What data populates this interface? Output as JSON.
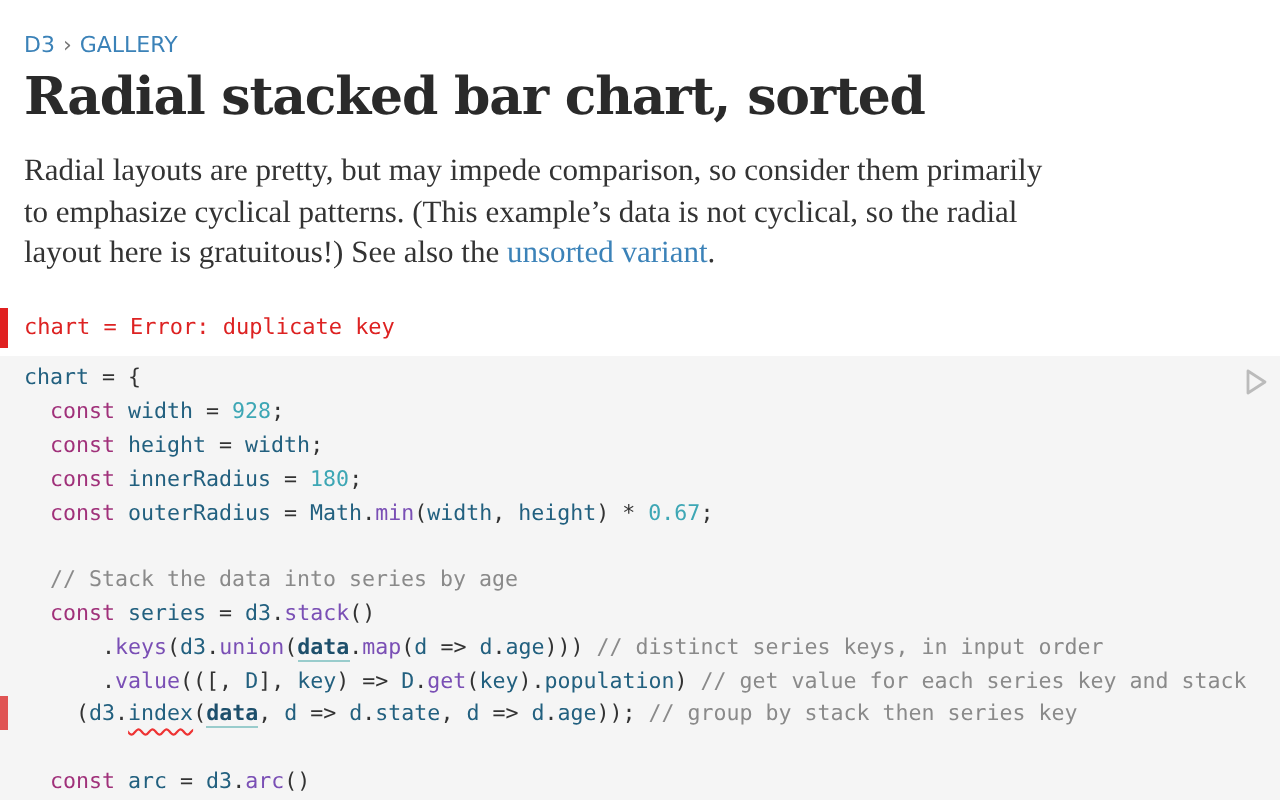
{
  "breadcrumb": {
    "items": [
      "D3",
      "GALLERY"
    ],
    "separator": "›"
  },
  "title": "Radial stacked bar chart, sorted",
  "description": {
    "text": "Radial layouts are pretty, but may impede comparison, so consider them primarily to emphasize cyclical patterns. (This example’s data is not cyclical, so the radial layout here is gratuitous!) See also the ",
    "link": "unsorted variant",
    "after": "."
  },
  "error_cell": {
    "text": "chart = Error: duplicate key"
  },
  "code": [
    {
      "flagged": false,
      "tokens": [
        {
          "kind": "variable",
          "text": "chart"
        },
        {
          "kind": "punct",
          "text": " = {"
        }
      ]
    },
    {
      "flagged": false,
      "tokens": [
        {
          "kind": "keyword",
          "text": "  const "
        },
        {
          "kind": "variable",
          "text": "width"
        },
        {
          "kind": "punct",
          "text": " = "
        },
        {
          "kind": "number",
          "text": "928"
        },
        {
          "kind": "punct",
          "text": ";"
        }
      ]
    },
    {
      "flagged": false,
      "tokens": [
        {
          "kind": "keyword",
          "text": "  const "
        },
        {
          "kind": "variable",
          "text": "height"
        },
        {
          "kind": "punct",
          "text": " = "
        },
        {
          "kind": "variable",
          "text": "width"
        },
        {
          "kind": "punct",
          "text": ";"
        }
      ]
    },
    {
      "flagged": false,
      "tokens": [
        {
          "kind": "keyword",
          "text": "  const "
        },
        {
          "kind": "variable",
          "text": "innerRadius"
        },
        {
          "kind": "punct",
          "text": " = "
        },
        {
          "kind": "number",
          "text": "180"
        },
        {
          "kind": "punct",
          "text": ";"
        }
      ]
    },
    {
      "flagged": false,
      "tokens": [
        {
          "kind": "keyword",
          "text": "  const "
        },
        {
          "kind": "variable",
          "text": "outerRadius"
        },
        {
          "kind": "punct",
          "text": " = "
        },
        {
          "kind": "variable",
          "text": "Math"
        },
        {
          "kind": "punct",
          "text": "."
        },
        {
          "kind": "method",
          "text": "min"
        },
        {
          "kind": "punct",
          "text": "("
        },
        {
          "kind": "variable",
          "text": "width"
        },
        {
          "kind": "punct",
          "text": ", "
        },
        {
          "kind": "variable",
          "text": "height"
        },
        {
          "kind": "punct",
          "text": ") * "
        },
        {
          "kind": "number",
          "text": "0.67"
        },
        {
          "kind": "punct",
          "text": ";"
        }
      ]
    },
    {
      "flagged": false
    },
    {
      "flagged": false,
      "tokens": [
        {
          "kind": "comment",
          "text": "  // Stack the data into series by age"
        }
      ]
    },
    {
      "flagged": false,
      "tokens": [
        {
          "kind": "keyword",
          "text": "  const "
        },
        {
          "kind": "variable",
          "text": "series"
        },
        {
          "kind": "punct",
          "text": " = "
        },
        {
          "kind": "variable",
          "text": "d3"
        },
        {
          "kind": "punct",
          "text": "."
        },
        {
          "kind": "method",
          "text": "stack"
        },
        {
          "kind": "punct",
          "text": "()"
        }
      ]
    },
    {
      "flagged": false,
      "tokens": [
        {
          "kind": "punct",
          "text": "      ."
        },
        {
          "kind": "method",
          "text": "keys"
        },
        {
          "kind": "punct",
          "text": "("
        },
        {
          "kind": "variable",
          "text": "d3"
        },
        {
          "kind": "punct",
          "text": "."
        },
        {
          "kind": "method",
          "text": "union"
        },
        {
          "kind": "punct",
          "text": "("
        },
        {
          "kind": "global",
          "text": "data"
        },
        {
          "kind": "punct",
          "text": "."
        },
        {
          "kind": "method",
          "text": "map"
        },
        {
          "kind": "punct",
          "text": "("
        },
        {
          "kind": "variable",
          "text": "d"
        },
        {
          "kind": "punct",
          "text": " => "
        },
        {
          "kind": "variable",
          "text": "d"
        },
        {
          "kind": "punct",
          "text": "."
        },
        {
          "kind": "variable",
          "text": "age"
        },
        {
          "kind": "punct",
          "text": "))) "
        },
        {
          "kind": "comment",
          "text": "// distinct series keys, in input order"
        }
      ]
    },
    {
      "flagged": false,
      "tokens": [
        {
          "kind": "punct",
          "text": "      ."
        },
        {
          "kind": "method",
          "text": "value"
        },
        {
          "kind": "punct",
          "text": "((["
        },
        {
          "kind": "punct",
          "text": ", "
        },
        {
          "kind": "variable",
          "text": "D"
        },
        {
          "kind": "punct",
          "text": "], "
        },
        {
          "kind": "variable",
          "text": "key"
        },
        {
          "kind": "punct",
          "text": ") => "
        },
        {
          "kind": "variable",
          "text": "D"
        },
        {
          "kind": "punct",
          "text": "."
        },
        {
          "kind": "method",
          "text": "get"
        },
        {
          "kind": "punct",
          "text": "("
        },
        {
          "kind": "variable",
          "text": "key"
        },
        {
          "kind": "punct",
          "text": ")."
        },
        {
          "kind": "variable",
          "text": "population"
        },
        {
          "kind": "punct",
          "text": ") "
        },
        {
          "kind": "comment",
          "text": "// get value for each series key and stack"
        }
      ]
    },
    {
      "flagged": true,
      "tokens": [
        {
          "kind": "punct",
          "text": "    ("
        },
        {
          "kind": "variable",
          "text": "d3"
        },
        {
          "kind": "punct",
          "text": "."
        },
        {
          "kind": "error",
          "text": "index"
        },
        {
          "kind": "punct",
          "text": "("
        },
        {
          "kind": "global",
          "text": "data"
        },
        {
          "kind": "punct",
          "text": ", "
        },
        {
          "kind": "variable",
          "text": "d"
        },
        {
          "kind": "punct",
          "text": " => "
        },
        {
          "kind": "variable",
          "text": "d"
        },
        {
          "kind": "punct",
          "text": "."
        },
        {
          "kind": "variable",
          "text": "state"
        },
        {
          "kind": "punct",
          "text": ", "
        },
        {
          "kind": "variable",
          "text": "d"
        },
        {
          "kind": "punct",
          "text": " => "
        },
        {
          "kind": "variable",
          "text": "d"
        },
        {
          "kind": "punct",
          "text": "."
        },
        {
          "kind": "variable",
          "text": "age"
        },
        {
          "kind": "punct",
          "text": ")); "
        },
        {
          "kind": "comment",
          "text": "// group by stack then series key"
        }
      ]
    },
    {
      "flagged": false
    },
    {
      "flagged": false,
      "tokens": [
        {
          "kind": "keyword",
          "text": "  const "
        },
        {
          "kind": "variable",
          "text": "arc"
        },
        {
          "kind": "punct",
          "text": " = "
        },
        {
          "kind": "variable",
          "text": "d3"
        },
        {
          "kind": "punct",
          "text": "."
        },
        {
          "kind": "method",
          "text": "arc"
        },
        {
          "kind": "punct",
          "text": "()"
        }
      ]
    }
  ]
}
